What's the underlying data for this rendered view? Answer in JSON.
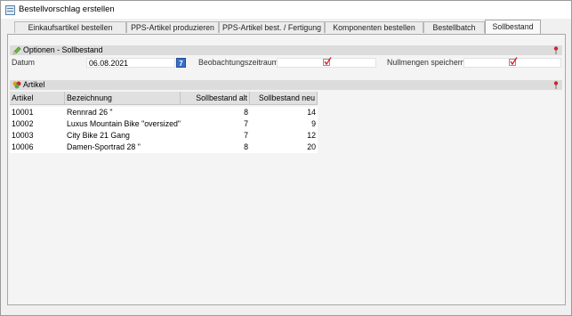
{
  "window": {
    "title": "Bestellvorschlag erstellen"
  },
  "tabs": [
    {
      "label": "Einkaufsartikel bestellen",
      "active": false
    },
    {
      "label": "PPS-Artikel produzieren",
      "active": false
    },
    {
      "label": "PPS-Artikel best. / Fertigung",
      "active": false
    },
    {
      "label": "Komponenten bestellen",
      "active": false
    },
    {
      "label": "Bestellbatch",
      "active": false
    },
    {
      "label": "Sollbestand",
      "active": true
    }
  ],
  "options": {
    "title": "Optionen - Sollbestand",
    "date_label": "Datum",
    "date_value": "06.08.2021",
    "calendar_button": "7",
    "observation_label": "Beobachtungszeitraum",
    "observation_checked": true,
    "zero_label": "Nullmengen speichern",
    "zero_checked": true
  },
  "articles": {
    "title": "Artikel",
    "columns": [
      "Artikel",
      "Bezeichnung",
      "Sollbestand alt",
      "Sollbestand neu"
    ],
    "rows": [
      {
        "artikel": "10001",
        "bezeichnung": "Rennrad 26 \"",
        "alt": "8",
        "neu": "14"
      },
      {
        "artikel": "10002",
        "bezeichnung": "Luxus Mountain Bike \"oversized\"",
        "alt": "7",
        "neu": "9"
      },
      {
        "artikel": "10003",
        "bezeichnung": "City Bike 21 Gang",
        "alt": "7",
        "neu": "12"
      },
      {
        "artikel": "10006",
        "bezeichnung": "Damen-Sportrad 28 \"",
        "alt": "8",
        "neu": "20"
      }
    ]
  },
  "colors": {
    "accent": "#3a6fc4",
    "check": "#d4232a",
    "section_bg": "#dcdcdc"
  }
}
